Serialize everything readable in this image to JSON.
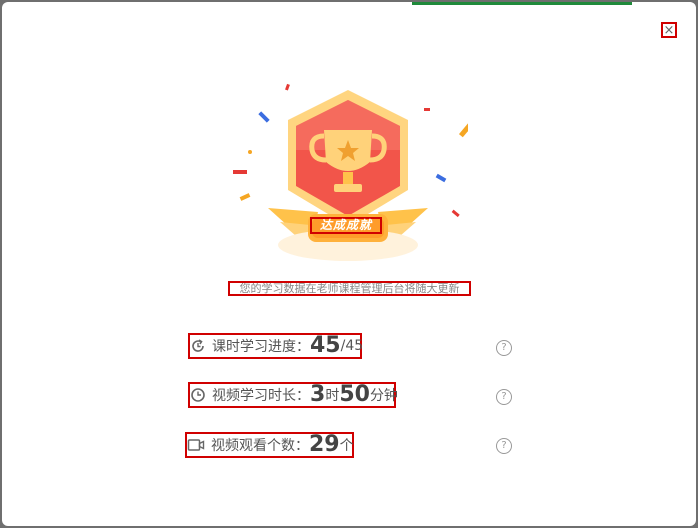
{
  "dialog": {
    "close_label": "×",
    "badge_text": "达成成就",
    "notice": "您的学习数据在老师课程管理后台将随大更新"
  },
  "stats": [
    {
      "icon": "progress-icon",
      "label": "课时学习进度：",
      "value": "45",
      "suffix": "/45"
    },
    {
      "icon": "clock-icon",
      "label": "视频学习时长：",
      "hours": "3",
      "hours_unit": "时",
      "minutes": "50",
      "minutes_unit": "分钟"
    },
    {
      "icon": "video-icon",
      "label": "视频观看个数：",
      "value": "29",
      "suffix": "个"
    }
  ],
  "help_label": "?",
  "colors": {
    "accent_red": "#d00000",
    "trophy_red": "#f2554a",
    "trophy_gold": "#ffc24a"
  }
}
